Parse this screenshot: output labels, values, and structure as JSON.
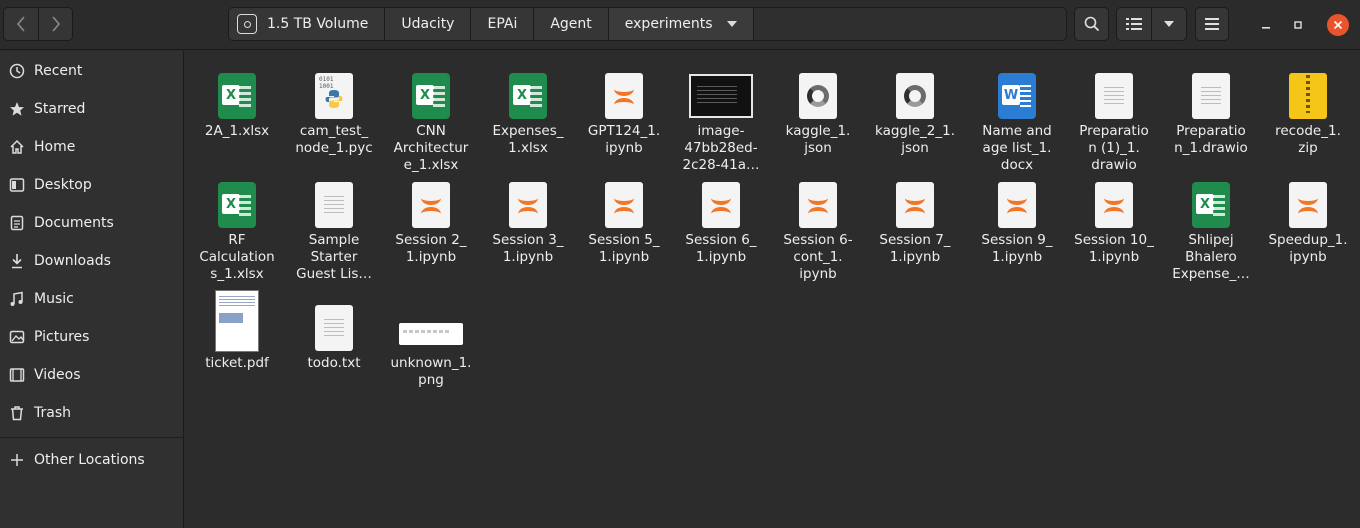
{
  "breadcrumbs": [
    "1.5 TB Volume",
    "Udacity",
    "EPAi",
    "Agent",
    "experiments"
  ],
  "sidebar": {
    "items": [
      {
        "label": "Recent",
        "icon": "clock-icon"
      },
      {
        "label": "Starred",
        "icon": "star-icon"
      },
      {
        "label": "Home",
        "icon": "home-icon"
      },
      {
        "label": "Desktop",
        "icon": "desktop-icon"
      },
      {
        "label": "Documents",
        "icon": "documents-icon"
      },
      {
        "label": "Downloads",
        "icon": "downloads-icon"
      },
      {
        "label": "Music",
        "icon": "music-icon"
      },
      {
        "label": "Pictures",
        "icon": "pictures-icon"
      },
      {
        "label": "Videos",
        "icon": "videos-icon"
      },
      {
        "label": "Trash",
        "icon": "trash-icon"
      }
    ],
    "other_locations": "Other Locations"
  },
  "files": [
    {
      "name": "2A_1.xlsx",
      "type": "xlsx"
    },
    {
      "name": "cam_test_\nnode_1.pyc",
      "type": "pyc"
    },
    {
      "name": "CNN\nArchitectur\ne_1.xlsx",
      "type": "xlsx"
    },
    {
      "name": "Expenses_\n1.xlsx",
      "type": "xlsx"
    },
    {
      "name": "GPT124_1.\nipynb",
      "type": "ipynb"
    },
    {
      "name": "image-\n47bb28ed-\n2c28-41a…",
      "type": "image"
    },
    {
      "name": "kaggle_1.\njson",
      "type": "json"
    },
    {
      "name": "kaggle_2_1.\njson",
      "type": "json"
    },
    {
      "name": "Name and\nage list_1.\ndocx",
      "type": "docx"
    },
    {
      "name": "Preparatio\nn (1)_1.\ndrawio",
      "type": "text"
    },
    {
      "name": "Preparatio\nn_1.drawio",
      "type": "text"
    },
    {
      "name": "recode_1.\nzip",
      "type": "zip"
    },
    {
      "name": "RF\nCalculation\ns_1.xlsx",
      "type": "xlsx"
    },
    {
      "name": "Sample\nStarter\nGuest Lis…",
      "type": "text"
    },
    {
      "name": "Session 2_\n1.ipynb",
      "type": "ipynb"
    },
    {
      "name": "Session 3_\n1.ipynb",
      "type": "ipynb"
    },
    {
      "name": "Session 5_\n1.ipynb",
      "type": "ipynb"
    },
    {
      "name": "Session 6_\n1.ipynb",
      "type": "ipynb"
    },
    {
      "name": "Session 6-\ncont_1.\nipynb",
      "type": "ipynb"
    },
    {
      "name": "Session 7_\n1.ipynb",
      "type": "ipynb"
    },
    {
      "name": "Session 9_\n1.ipynb",
      "type": "ipynb"
    },
    {
      "name": "Session 10_\n1.ipynb",
      "type": "ipynb"
    },
    {
      "name": "Shlipej\nBhalero\nExpense_…",
      "type": "xlsx"
    },
    {
      "name": "Speedup_1.\nipynb",
      "type": "ipynb"
    },
    {
      "name": "ticket.pdf",
      "type": "pdf"
    },
    {
      "name": "todo.txt",
      "type": "text"
    },
    {
      "name": "unknown_1.\npng",
      "type": "png"
    }
  ]
}
